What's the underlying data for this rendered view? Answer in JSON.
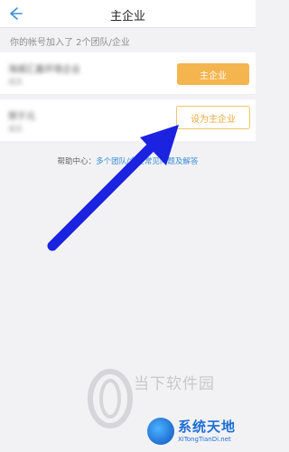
{
  "header": {
    "title": "主企业"
  },
  "section_label": "你的帐号加入了 2个团队/企业",
  "orgs": [
    {
      "name": "海城汇鑫环境企业",
      "sub": "成员",
      "button": "主企业"
    },
    {
      "name": "邢于元",
      "sub": "成员",
      "button": "设为主企业"
    }
  ],
  "help": {
    "prefix": "帮助中心：",
    "link": "多个团队/企业常见问题及解答"
  },
  "watermarks": {
    "dangxia": "当下软件园",
    "xitong": "系统天地",
    "xitong_sub": "XiTongTianDi.net"
  },
  "colors": {
    "accent": "#f4b54e",
    "link": "#3a8fd9",
    "annotation_arrow": "#1b22e0"
  }
}
